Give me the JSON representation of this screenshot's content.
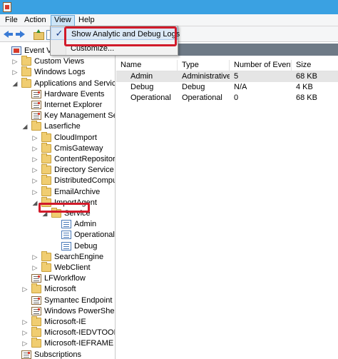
{
  "menu": {
    "file": "File",
    "action": "Action",
    "view": "View",
    "help": "Help"
  },
  "view_menu": {
    "items": [
      {
        "label": "Show Analytic and Debug Logs",
        "checked": true
      },
      {
        "label": "Customize...",
        "checked": false
      }
    ]
  },
  "tree": {
    "items": [
      {
        "label": "Event Viewe",
        "icon": "viewer-icon",
        "level": 0,
        "exp": ""
      },
      {
        "label": "Custom Views",
        "icon": "folder-icon",
        "level": 1,
        "exp": "▷"
      },
      {
        "label": "Windows Logs",
        "icon": "folder-icon",
        "level": 1,
        "exp": "▷"
      },
      {
        "label": "Applications and Services Lo",
        "icon": "folder-icon",
        "level": 1,
        "exp": "◢"
      },
      {
        "label": "Hardware Events",
        "icon": "log-icon",
        "level": 2,
        "exp": ""
      },
      {
        "label": "Internet Explorer",
        "icon": "log-icon",
        "level": 2,
        "exp": ""
      },
      {
        "label": "Key Management Service",
        "icon": "log-icon",
        "level": 2,
        "exp": ""
      },
      {
        "label": "Laserfiche",
        "icon": "folder-icon",
        "level": 2,
        "exp": "◢"
      },
      {
        "label": "CloudImport",
        "icon": "folder-icon",
        "level": 3,
        "exp": "▷"
      },
      {
        "label": "CmisGateway",
        "icon": "folder-icon",
        "level": 3,
        "exp": "▷"
      },
      {
        "label": "ContentRepository",
        "icon": "folder-icon",
        "level": 3,
        "exp": "▷"
      },
      {
        "label": "Directory Service",
        "icon": "folder-icon",
        "level": 3,
        "exp": "▷"
      },
      {
        "label": "DistributedComputin",
        "icon": "folder-icon",
        "level": 3,
        "exp": "▷"
      },
      {
        "label": "EmailArchive",
        "icon": "folder-icon",
        "level": 3,
        "exp": "▷"
      },
      {
        "label": "ImportAgent",
        "icon": "folder-icon",
        "level": 3,
        "exp": "◢"
      },
      {
        "label": "Service",
        "icon": "folder-icon",
        "level": 4,
        "exp": "◢"
      },
      {
        "label": "Admin",
        "icon": "logblue-icon",
        "level": 5,
        "exp": ""
      },
      {
        "label": "Operational",
        "icon": "logblue-icon",
        "level": 5,
        "exp": ""
      },
      {
        "label": "Debug",
        "icon": "logblue-icon",
        "level": 5,
        "exp": ""
      },
      {
        "label": "SearchEngine",
        "icon": "folder-icon",
        "level": 3,
        "exp": "▷"
      },
      {
        "label": "WebClient",
        "icon": "folder-icon",
        "level": 3,
        "exp": "▷"
      },
      {
        "label": "LFWorkflow",
        "icon": "log-icon",
        "level": 2,
        "exp": ""
      },
      {
        "label": "Microsoft",
        "icon": "folder-icon",
        "level": 2,
        "exp": "▷"
      },
      {
        "label": "Symantec Endpoint Prote",
        "icon": "log-icon",
        "level": 2,
        "exp": ""
      },
      {
        "label": "Windows PowerShell",
        "icon": "log-icon",
        "level": 2,
        "exp": ""
      },
      {
        "label": "Microsoft-IE",
        "icon": "folder-icon",
        "level": 2,
        "exp": "▷"
      },
      {
        "label": "Microsoft-IEDVTOOL",
        "icon": "folder-icon",
        "level": 2,
        "exp": "▷"
      },
      {
        "label": "Microsoft-IEFRAME",
        "icon": "folder-icon",
        "level": 2,
        "exp": "▷"
      },
      {
        "label": "Subscriptions",
        "icon": "log-icon",
        "level": 1,
        "exp": ""
      }
    ]
  },
  "table": {
    "columns": [
      "Name",
      "Type",
      "Number of Events",
      "Size"
    ],
    "rows": [
      [
        "Admin",
        "Administrative",
        "5",
        "68 KB"
      ],
      [
        "Debug",
        "Debug",
        "N/A",
        "4 KB"
      ],
      [
        "Operational",
        "Operational",
        "0",
        "68 KB"
      ]
    ]
  },
  "colors": {
    "highlight": "#d11a2a",
    "titlebar": "#3aa1e2",
    "selection": "#e5e5e5"
  }
}
